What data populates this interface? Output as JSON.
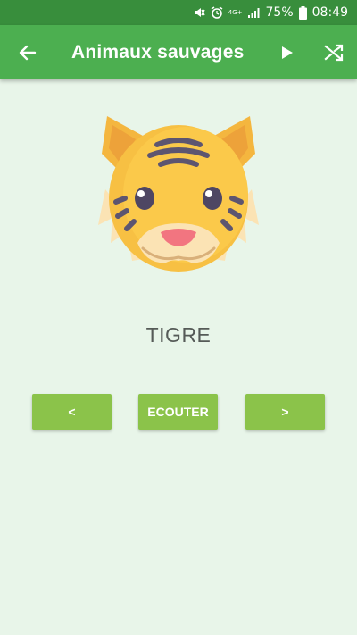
{
  "status_bar": {
    "network": "4G+",
    "battery_percent": "75%",
    "time": "08:49",
    "icons": [
      "mute-icon",
      "alarm-icon",
      "signal-icon",
      "battery-icon"
    ]
  },
  "app_bar": {
    "title": "Animaux sauvages",
    "back_icon": "arrow-left-icon",
    "play_icon": "play-icon",
    "shuffle_icon": "shuffle-icon"
  },
  "main": {
    "animal_name": "TIGRE",
    "animal_icon": "tiger-face-icon"
  },
  "controls": {
    "prev_label": "<",
    "listen_label": "ECOUTER",
    "next_label": ">"
  },
  "colors": {
    "status_bar": "#388e3c",
    "app_bar": "#4caf50",
    "background": "#e8f5e9",
    "button": "#8bc34a"
  }
}
